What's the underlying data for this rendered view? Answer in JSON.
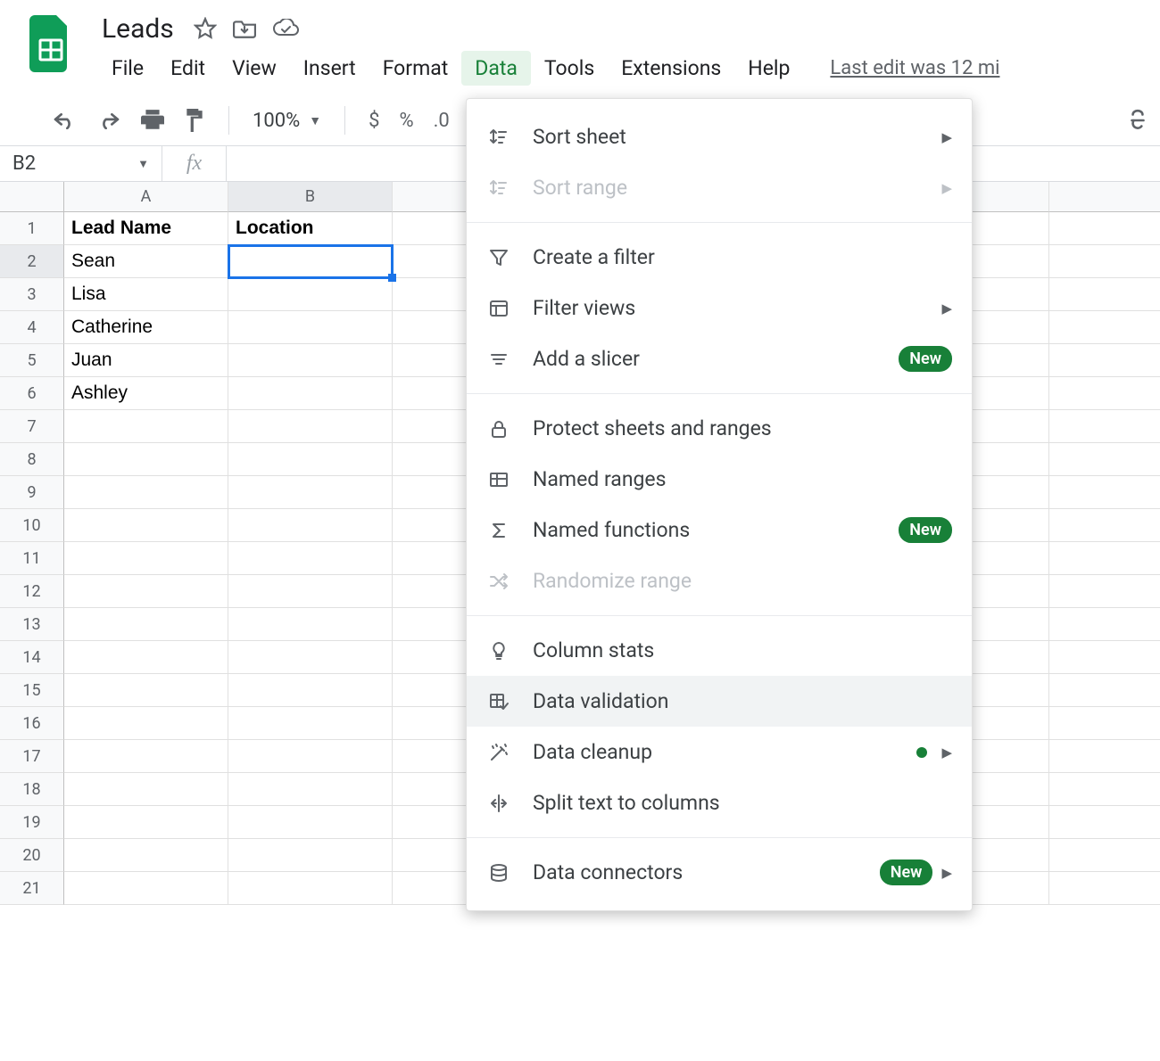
{
  "doc": {
    "title": "Leads"
  },
  "menu": {
    "items": [
      "File",
      "Edit",
      "View",
      "Insert",
      "Format",
      "Data",
      "Tools",
      "Extensions",
      "Help"
    ],
    "active": "Data",
    "last_edit": "Last edit was 12 mi"
  },
  "toolbar": {
    "zoom": "100%",
    "currency": "$",
    "percent": "%",
    "decimal": ".0"
  },
  "namebox": {
    "ref": "B2"
  },
  "fx_label": "fx",
  "columns": [
    "A",
    "B",
    "",
    "",
    "",
    "",
    "",
    ""
  ],
  "selected_col_index": 1,
  "rows": {
    "count": 21,
    "selected_row": 2,
    "data": [
      {
        "A": "Lead Name",
        "B": "Location",
        "bold": true
      },
      {
        "A": "Sean",
        "B": ""
      },
      {
        "A": "Lisa",
        "B": ""
      },
      {
        "A": "Catherine",
        "B": ""
      },
      {
        "A": "Juan",
        "B": ""
      },
      {
        "A": "Ashley",
        "B": ""
      }
    ]
  },
  "data_menu": [
    {
      "label": "Sort sheet",
      "icon": "sort-sheet-icon",
      "arrow": true
    },
    {
      "label": "Sort range",
      "icon": "sort-range-icon",
      "arrow": true,
      "disabled": true
    },
    {
      "sep": true
    },
    {
      "label": "Create a filter",
      "icon": "filter-icon"
    },
    {
      "label": "Filter views",
      "icon": "filter-views-icon",
      "arrow": true
    },
    {
      "label": "Add a slicer",
      "icon": "slicer-icon",
      "badge": "New"
    },
    {
      "sep": true
    },
    {
      "label": "Protect sheets and ranges",
      "icon": "lock-icon"
    },
    {
      "label": "Named ranges",
      "icon": "named-ranges-icon"
    },
    {
      "label": "Named functions",
      "icon": "sigma-icon",
      "badge": "New"
    },
    {
      "label": "Randomize range",
      "icon": "shuffle-icon",
      "disabled": true
    },
    {
      "sep": true
    },
    {
      "label": "Column stats",
      "icon": "bulb-icon"
    },
    {
      "label": "Data validation",
      "icon": "validation-icon",
      "hovered": true
    },
    {
      "label": "Data cleanup",
      "icon": "wand-icon",
      "dot": true,
      "arrow": true
    },
    {
      "label": "Split text to columns",
      "icon": "split-icon"
    },
    {
      "sep": true
    },
    {
      "label": "Data connectors",
      "icon": "db-icon",
      "badge": "New",
      "arrow": true
    }
  ]
}
